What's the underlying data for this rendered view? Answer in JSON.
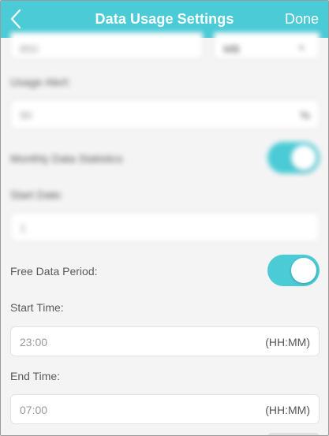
{
  "header": {
    "title": "Data Usage Settings",
    "done_label": "Done"
  },
  "total_data": {
    "value": "850",
    "unit": "MB"
  },
  "usage_alert": {
    "label": "Usage Alert:",
    "value": "90",
    "suffix": "%"
  },
  "monthly_stats": {
    "label": "Monthly Data Statistics",
    "enabled": true
  },
  "start_date": {
    "label": "Start Date:",
    "value": "1"
  },
  "free_period": {
    "label": "Free Data Period:",
    "enabled": true
  },
  "start_time": {
    "label": "Start Time:",
    "value": "23:00",
    "suffix": "(HH:MM)"
  },
  "end_time": {
    "label": "End Time:",
    "value": "07:00",
    "suffix": "(HH:MM)"
  },
  "colors": {
    "accent": "#4acbd6",
    "background": "#f4f4f4"
  },
  "icons": {
    "back": "chevron-left-icon",
    "dropdown": "chevron-down-icon"
  }
}
